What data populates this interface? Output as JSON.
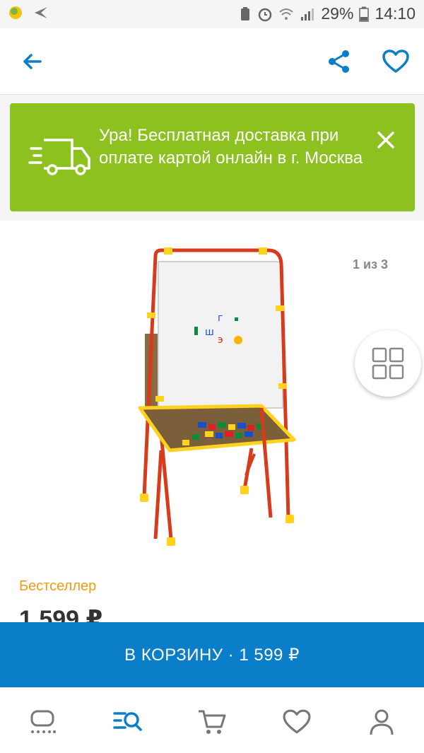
{
  "status_bar": {
    "battery_percent": "29%",
    "time": "14:10"
  },
  "app_bar": {
    "back_icon": "arrow-left-icon",
    "share_icon": "share-icon",
    "favorite_icon": "heart-icon"
  },
  "promo": {
    "text": "Ура! Бесплатная доставка при оплате картой онлайн в г. Москва",
    "icon": "delivery-truck-icon",
    "close_icon": "close-icon"
  },
  "product": {
    "image_counter": "1 из 3",
    "badge": "Бестселлер",
    "price": "1 599 ₽",
    "gallery_icon": "grid-icon"
  },
  "cart_button": {
    "label": "В КОРЗИНУ · 1 599 ₽"
  },
  "bottom_nav": {
    "items": [
      {
        "icon": "home-icon"
      },
      {
        "icon": "catalog-search-icon"
      },
      {
        "icon": "cart-icon"
      },
      {
        "icon": "heart-icon"
      },
      {
        "icon": "profile-icon"
      }
    ]
  },
  "colors": {
    "accent": "#0b7ec9",
    "promo": "#8cc11f",
    "badge": "#f39c12"
  }
}
